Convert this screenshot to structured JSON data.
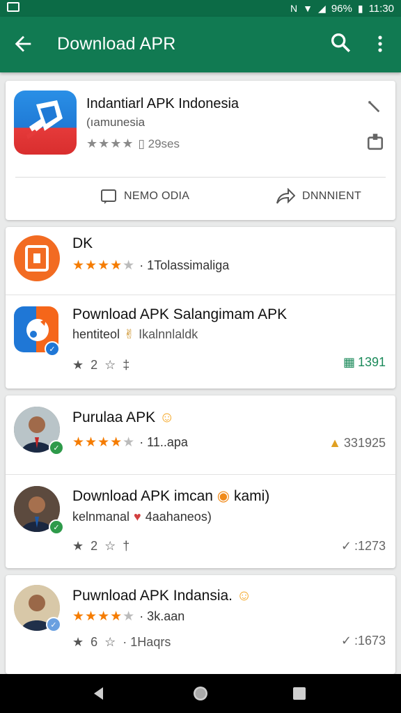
{
  "status_bar": {
    "battery": "96%",
    "time": "11:30"
  },
  "app_bar": {
    "title": "Download APR"
  },
  "top_card": {
    "name": "Indantiarl APK Indonesia",
    "developer": "(ıamunesia",
    "rating_stars": 4,
    "rating_text": "▯ 29ses",
    "action_left": "NEMO ODIA",
    "action_right": "DNNNIENT"
  },
  "list_card_1": {
    "item_1": {
      "title": "DK",
      "rating_stars": 4,
      "rating_text": "· 1Tolassimaliga"
    },
    "item_2": {
      "title": "Pownload APK Salangimam APK",
      "subtitle_a": "hentiteol",
      "subtitle_b": "Ikalnnlaldk",
      "meta_a": "2",
      "meta_b": "‡",
      "right_value": "1391",
      "right_color": "#1b8a5a"
    }
  },
  "list_card_2": {
    "item_1": {
      "title": "Purulaa APK",
      "rating_stars": 4,
      "rating_text": "· 11..apa",
      "right_value": "331925"
    },
    "item_2": {
      "title_a": "Download APK imcan",
      "title_b": "kami)",
      "subtitle_a": "kelnmanal",
      "subtitle_b": "4aahaneos)",
      "meta_a": "2",
      "right_value": ":1273"
    }
  },
  "list_card_3": {
    "item_1": {
      "title": "Puwnload APK Indansia.",
      "rating_text": "· 3k.aan",
      "meta_a": "6",
      "meta_b": "· 1Haqrs",
      "right_value": ":1673"
    }
  },
  "colors": {
    "status": "#0c6b46",
    "app_bar": "#117a52",
    "star": "#f57c00"
  }
}
